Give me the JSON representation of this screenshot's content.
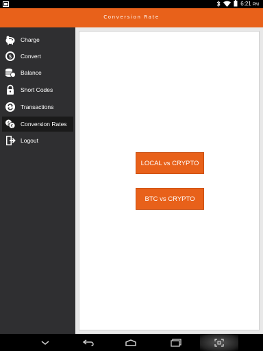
{
  "status_bar": {
    "time": "6:21",
    "ampm": "PM",
    "icons": [
      "screenshot-icon",
      "bluetooth-icon",
      "wifi-icon",
      "battery-icon"
    ]
  },
  "header": {
    "title": "Conversion Rate",
    "color": "#e8611a"
  },
  "sidebar": {
    "items": [
      {
        "label": "Charge",
        "icon": "piggy-bank-icon"
      },
      {
        "label": "Convert",
        "icon": "convert-coin-icon"
      },
      {
        "label": "Balance",
        "icon": "coins-stack-icon"
      },
      {
        "label": "Short Codes",
        "icon": "lock-icon"
      },
      {
        "label": "Transactions",
        "icon": "cycle-arrows-icon"
      },
      {
        "label": "Conversion Rates",
        "icon": "exchange-coins-icon",
        "selected": true
      },
      {
        "label": "Logout",
        "icon": "logout-icon"
      }
    ]
  },
  "main": {
    "buttons": [
      {
        "label": "LOCAL vs CRYPTO"
      },
      {
        "label": "BTC vs CRYPTO"
      }
    ]
  },
  "navbar": {
    "icons": [
      "hide-keyboard-icon",
      "back-icon",
      "home-icon",
      "recent-apps-icon",
      "screenshot-scan-icon"
    ]
  }
}
